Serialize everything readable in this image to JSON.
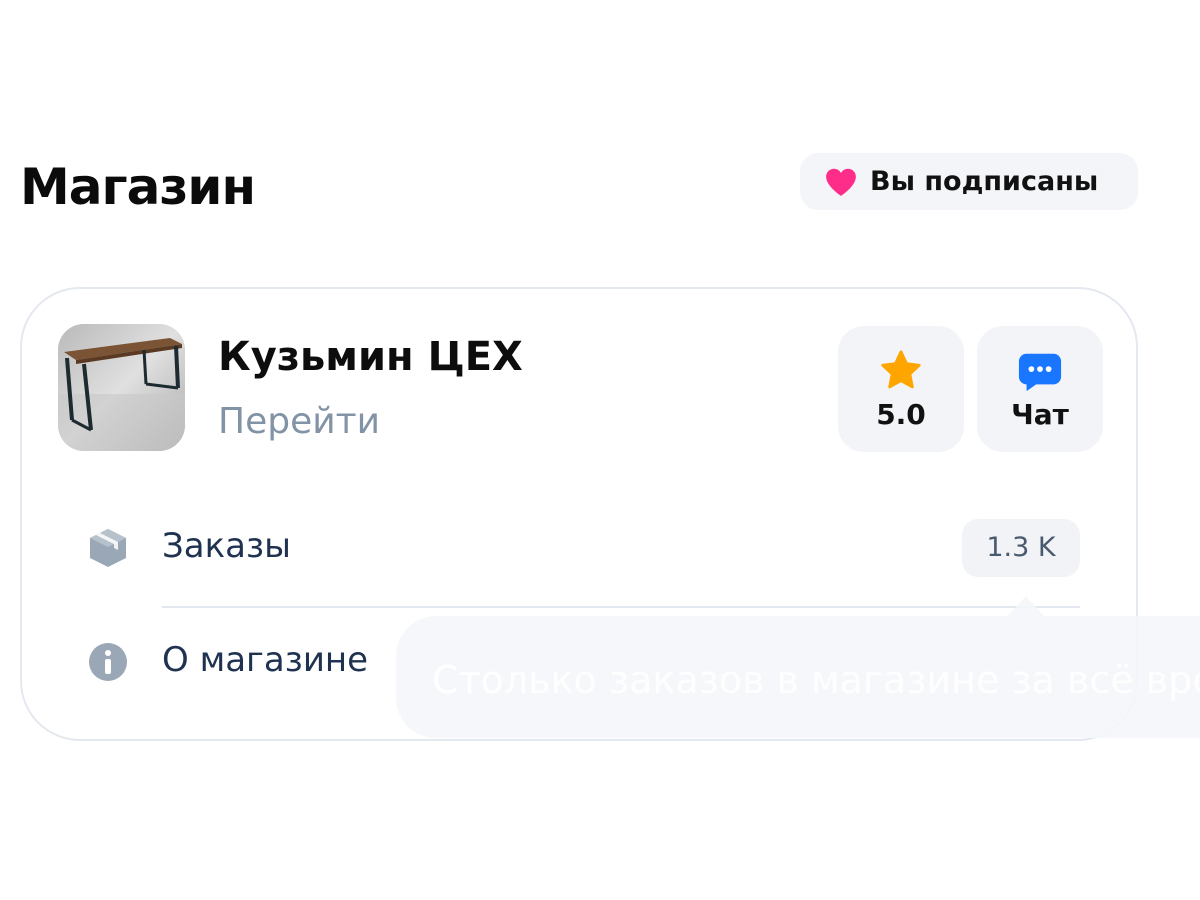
{
  "header": {
    "title": "Магазин",
    "subscribe_label": "Вы подписаны"
  },
  "store": {
    "name": "Кузьмин ЦЕХ",
    "go_link": "Перейти",
    "rating": "5.0",
    "chat_label": "Чат",
    "orders_label": "Заказы",
    "orders_count": "1.3 K",
    "about_label": "О магазине"
  },
  "tooltip": {
    "text": "Столько заказов в магазине за всё вре"
  },
  "colors": {
    "heart": "#ff2d8a",
    "star": "#ffa500",
    "chat_icon": "#1976ff",
    "muted_icon": "#9aa7b6"
  },
  "icons": {
    "subscribe": "heart-icon",
    "rating": "star-icon",
    "chat": "chat-bubble-icon",
    "orders": "box-icon",
    "about": "info-icon"
  }
}
